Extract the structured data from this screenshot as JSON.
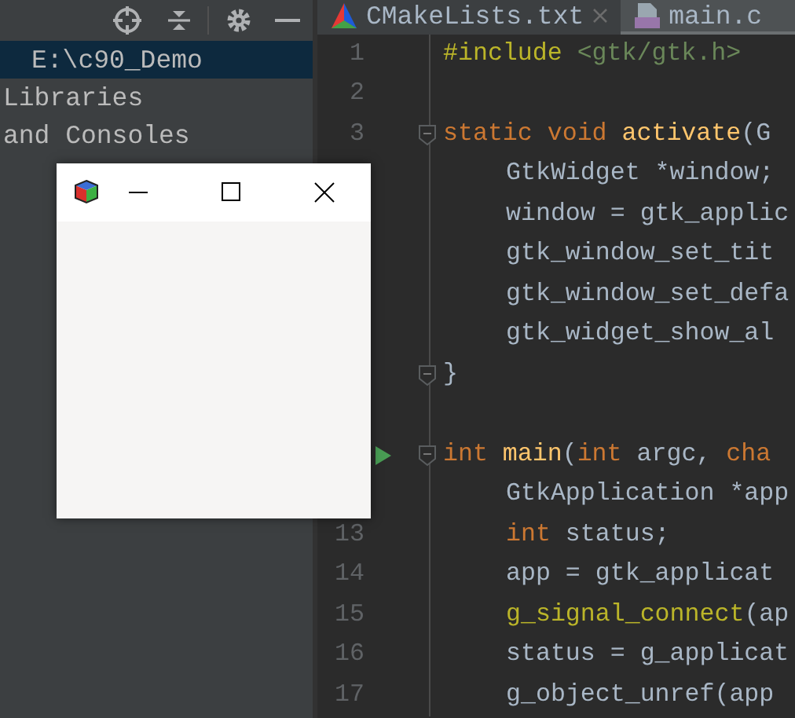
{
  "sidebar": {
    "items": [
      {
        "label": "E:\\c90_Demo",
        "selected": true,
        "indented": true
      },
      {
        "label": "Libraries",
        "selected": false,
        "indented": false
      },
      {
        "label": "and Consoles",
        "selected": false,
        "indented": false
      }
    ]
  },
  "editor": {
    "tabs": [
      {
        "label": "CMakeLists.txt",
        "kind": "cmake",
        "selected": false,
        "closable": true
      },
      {
        "label": "main.c",
        "kind": "c",
        "selected": true,
        "closable": false
      }
    ],
    "lines": [
      {
        "number": "1",
        "indented": false,
        "fold": false,
        "run": false,
        "tokens": [
          {
            "kind": "macro",
            "text": "#include "
          },
          {
            "kind": "string",
            "text": "<gtk/gtk.h>"
          }
        ]
      },
      {
        "number": "2",
        "fold": false,
        "run": false
      },
      {
        "number": "3",
        "indented": false,
        "fold": true,
        "run": false,
        "tokens": [
          {
            "kind": "keyword",
            "text": "static void "
          },
          {
            "kind": "function",
            "text": "activate"
          },
          {
            "kind": "plain",
            "text": "(G"
          }
        ]
      },
      {
        "indented": true,
        "fold": false,
        "run": false,
        "tokens": [
          {
            "kind": "plain",
            "text": "GtkWidget *window;"
          }
        ]
      },
      {
        "indented": true,
        "fold": false,
        "run": false,
        "tokens": [
          {
            "kind": "plain",
            "text": "window = gtk_applic"
          }
        ]
      },
      {
        "indented": true,
        "fold": false,
        "run": false,
        "tokens": [
          {
            "kind": "plain",
            "text": "gtk_window_set_tit"
          }
        ]
      },
      {
        "indented": true,
        "fold": false,
        "run": false,
        "tokens": [
          {
            "kind": "plain",
            "text": "gtk_window_set_defa"
          }
        ]
      },
      {
        "indented": true,
        "fold": false,
        "run": false,
        "tokens": [
          {
            "kind": "plain",
            "text": "gtk_widget_show_al"
          }
        ]
      },
      {
        "indented": false,
        "fold": true,
        "run": false,
        "tokens": [
          {
            "kind": "plain",
            "text": "}"
          }
        ]
      },
      {
        "fold": false,
        "run": false
      },
      {
        "indented": false,
        "fold": true,
        "run": true,
        "tokens": [
          {
            "kind": "keyword",
            "text": "int "
          },
          {
            "kind": "function",
            "text": "main"
          },
          {
            "kind": "plain",
            "text": "("
          },
          {
            "kind": "keyword",
            "text": "int "
          },
          {
            "kind": "plain",
            "text": "argc, "
          },
          {
            "kind": "keyword",
            "text": "cha"
          }
        ]
      },
      {
        "indented": true,
        "fold": false,
        "run": false,
        "tokens": [
          {
            "kind": "plain",
            "text": "GtkApplication *app"
          }
        ]
      },
      {
        "number": "13",
        "indented": true,
        "fold": false,
        "run": false,
        "tokens": [
          {
            "kind": "keyword",
            "text": "int "
          },
          {
            "kind": "plain",
            "text": "status;"
          }
        ]
      },
      {
        "number": "14",
        "indented": true,
        "fold": false,
        "run": false,
        "tokens": [
          {
            "kind": "plain",
            "text": "app = gtk_applicat"
          }
        ]
      },
      {
        "number": "15",
        "indented": true,
        "fold": false,
        "run": false,
        "tokens": [
          {
            "kind": "macro",
            "text": "g_signal_connect"
          },
          {
            "kind": "plain",
            "text": "(ap"
          }
        ]
      },
      {
        "number": "16",
        "indented": true,
        "fold": false,
        "run": false,
        "tokens": [
          {
            "kind": "plain",
            "text": "status = g_applicat"
          }
        ]
      },
      {
        "number": "17",
        "indented": true,
        "fold": false,
        "run": false,
        "tokens": [
          {
            "kind": "plain",
            "text": "g_object_unref(app"
          }
        ]
      }
    ]
  }
}
